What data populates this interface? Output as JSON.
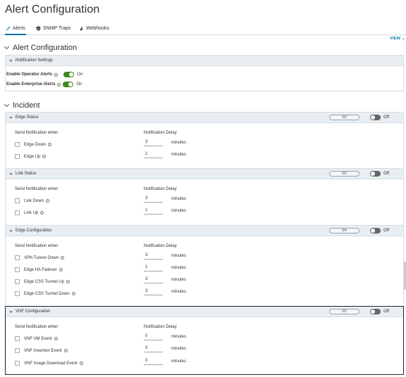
{
  "page": {
    "title": "Alert Configuration"
  },
  "tabs": [
    {
      "label": "Alerts",
      "icon": "wrench-icon",
      "active": true
    },
    {
      "label": "SNMP Traps",
      "icon": "shield-icon",
      "active": false
    },
    {
      "label": "Webhooks",
      "icon": "webhook-icon",
      "active": false
    }
  ],
  "view_link": "VIEW",
  "alert_section": {
    "title": "Alert Configuration"
  },
  "notification_settings": {
    "title": "Notification Settings",
    "items": [
      {
        "label": "Enable Operator Alerts",
        "state": "On"
      },
      {
        "label": "Enable Enterprise Alerts",
        "state": "On"
      }
    ]
  },
  "incident_section": {
    "title": "Incident"
  },
  "common": {
    "send_label": "Send Notification when",
    "delay_label": "Notification Delay",
    "unit": "minutes",
    "off_label": "Off"
  },
  "groups": [
    {
      "title": "Edge Status",
      "counter": "0/2",
      "rows": [
        {
          "label": "Edge Down",
          "delay": "3"
        },
        {
          "label": "Edge Up",
          "delay": "1"
        }
      ]
    },
    {
      "title": "Link Status",
      "counter": "0/2",
      "rows": [
        {
          "label": "Link Down",
          "delay": "3"
        },
        {
          "label": "Link Up",
          "delay": "1"
        }
      ]
    },
    {
      "title": "Edge Configuration",
      "counter": "0/4",
      "rows": [
        {
          "label": "VPN Tunnel Down",
          "delay": "3"
        },
        {
          "label": "Edge HA Failover",
          "delay": "1"
        },
        {
          "label": "Edge CSS Tunnel Up",
          "delay": "3"
        },
        {
          "label": "Edge CSS Tunnel Down",
          "delay": "3"
        }
      ]
    },
    {
      "title": "VNF Configuration",
      "counter": "0/3",
      "rows": [
        {
          "label": "VNF VM Event",
          "delay": "0"
        },
        {
          "label": "VNF Insertion Event",
          "delay": "0"
        },
        {
          "label": "VNF Image Download Event",
          "delay": "0"
        }
      ]
    }
  ],
  "colors": {
    "accent": "#0072a3",
    "toggle_on": "#3d8a1f",
    "toggle_off": "#666666",
    "header_bg": "#e8eef2"
  }
}
